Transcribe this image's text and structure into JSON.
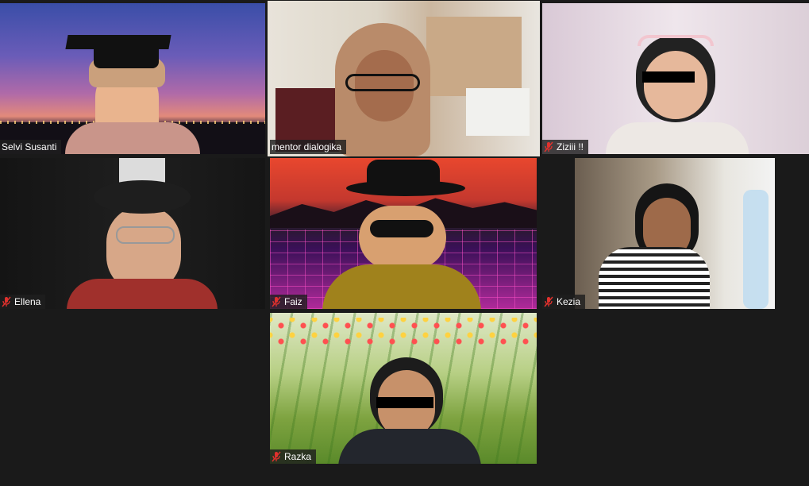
{
  "participants": [
    {
      "name": "Selvi Susanti",
      "muted": false,
      "active": false
    },
    {
      "name": "mentor dialogika",
      "muted": false,
      "active": true
    },
    {
      "name": "Ziziii !!",
      "muted": true,
      "active": false
    },
    {
      "name": "Ellena",
      "muted": true,
      "active": false
    },
    {
      "name": "Faiz",
      "muted": true,
      "active": false
    },
    {
      "name": "Kezia",
      "muted": true,
      "active": false
    },
    {
      "name": "Razka",
      "muted": true,
      "active": false
    }
  ],
  "colors": {
    "background": "#1a1a1a",
    "active_speaker_border": "#b8d92f",
    "mute_red": "#e0312d"
  },
  "icons": {
    "mute": "microphone-muted-icon"
  }
}
